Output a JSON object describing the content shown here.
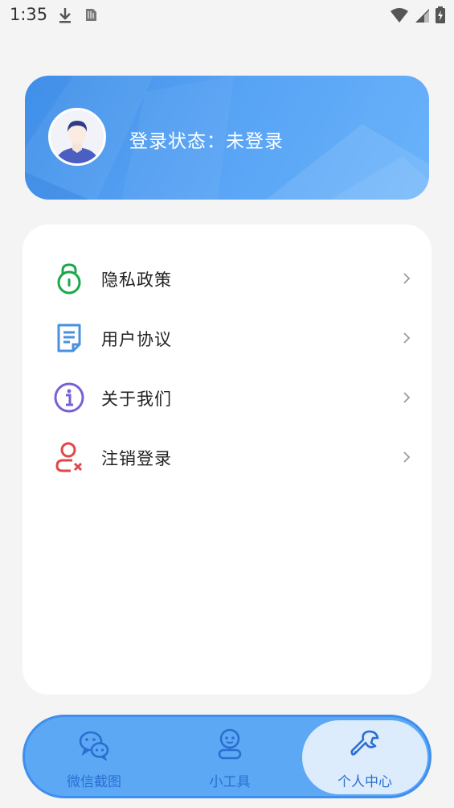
{
  "status_bar": {
    "time": "1:35",
    "icons": [
      "download-icon",
      "sim-card-icon",
      "wifi-icon",
      "signal-icon",
      "battery-charging-icon"
    ]
  },
  "profile": {
    "login_status": "登录状态：未登录",
    "avatar_icon": "user-avatar"
  },
  "menu": {
    "items": [
      {
        "label": "隐私政策",
        "icon": "lock-icon",
        "color": "#1aa84a"
      },
      {
        "label": "用户协议",
        "icon": "document-icon",
        "color": "#4a90e2"
      },
      {
        "label": "关于我们",
        "icon": "info-icon",
        "color": "#7a5fd3"
      },
      {
        "label": "注销登录",
        "icon": "user-remove-icon",
        "color": "#e04848"
      }
    ]
  },
  "tab_bar": {
    "tabs": [
      {
        "label": "微信截图",
        "icon": "wechat-icon",
        "active": false
      },
      {
        "label": "小工具",
        "icon": "robot-icon",
        "active": false
      },
      {
        "label": "个人中心",
        "icon": "wrench-icon",
        "active": true
      }
    ]
  },
  "colors": {
    "accent": "#5da8f5",
    "tab_text": "#2a6fd0",
    "background": "#f4f4f4"
  }
}
